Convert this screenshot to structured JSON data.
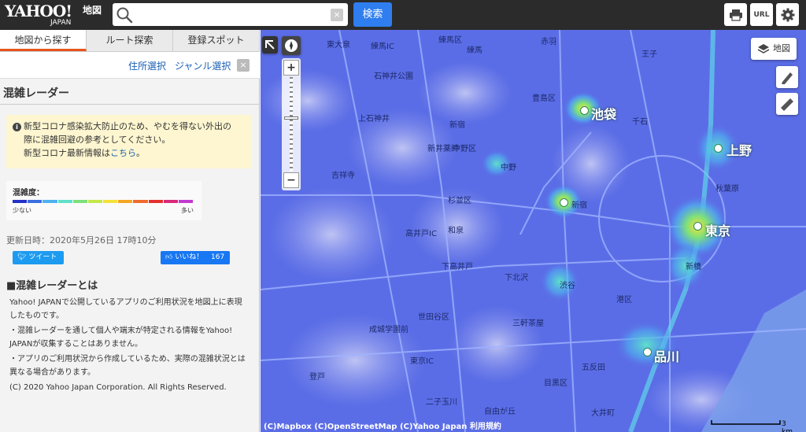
{
  "header": {
    "logo_main": "YAHOO!",
    "logo_sub": "JAPAN",
    "app_name": "地図",
    "search_placeholder": "",
    "search_button": "検索",
    "url_button": "URL",
    "icons": [
      "search-icon",
      "printer-icon",
      "gear-icon"
    ]
  },
  "panel": {
    "tabs": [
      "地図から探す",
      "ルート探索",
      "登録スポット"
    ],
    "subnav": {
      "address": "住所選択",
      "genre": "ジャンル選択",
      "close": "×"
    },
    "title": "混雑レーダー",
    "notice": {
      "line1": "新型コロナ感染拡大防止のため、やむを得ない外出の",
      "line2": "際に混雑回避の参考としてください。",
      "line3_prefix": "新型コロナ最新情報は",
      "line3_link": "こちら",
      "line3_suffix": "。"
    },
    "legend": {
      "title": "混雑度：",
      "low": "少ない",
      "high": "多い",
      "colors": [
        "#2431c9",
        "#3a6fe0",
        "#4fb1f0",
        "#5fe0c9",
        "#7ee07a",
        "#c4e84a",
        "#f5e13a",
        "#f5a623",
        "#ef6b2c",
        "#e5312e",
        "#d82a7a",
        "#c23ad1"
      ]
    },
    "updated": "更新日時：2020年5月26日 17時10分",
    "tweet": "ツイート",
    "like": "いいね！",
    "like_count": "167",
    "about_title": "■混雑レーダーとは",
    "about_p1": "Yahoo! JAPANで公開しているアプリのご利用状況を地図上に表現したものです。",
    "about_p2": "・混雑レーダーを通して個人や端末が特定される情報をYahoo! JAPANが収集することはありません。",
    "about_p3": "・アプリのご利用状況から作成しているため、実際の混雑状況とは異なる場合があります。",
    "about_p4": "(C) 2020 Yahoo Japan Corporation. All Rights Reserved."
  },
  "map": {
    "layer_button": "地図",
    "zoom_in": "+",
    "zoom_out": "−",
    "attribution": [
      "(C)Mapbox",
      "(C)OpenStreetMap",
      "(C)Yahoo Japan",
      "利用規約"
    ],
    "scale": "3 km",
    "labels": [
      {
        "t": "東大泉"
      },
      {
        "t": "練馬IC"
      },
      {
        "t": "練馬"
      },
      {
        "t": "練馬区"
      },
      {
        "t": "赤羽"
      },
      {
        "t": "王子"
      },
      {
        "t": "石神井公園"
      },
      {
        "t": "豊島区"
      },
      {
        "t": "上石神井"
      },
      {
        "t": "新宿"
      },
      {
        "t": "池袋"
      },
      {
        "t": "千石"
      },
      {
        "t": "新井薬師"
      },
      {
        "t": "中野区"
      },
      {
        "t": "上野"
      },
      {
        "t": "吉祥寺"
      },
      {
        "t": "中野"
      },
      {
        "t": "杉並区"
      },
      {
        "t": "秋葉原"
      },
      {
        "t": "新宿"
      },
      {
        "t": "東京"
      },
      {
        "t": "高井戸IC"
      },
      {
        "t": "和泉"
      },
      {
        "t": "新橋"
      },
      {
        "t": "下高井戸"
      },
      {
        "t": "下北沢"
      },
      {
        "t": "渋谷"
      },
      {
        "t": "港区"
      },
      {
        "t": "三軒茶屋"
      },
      {
        "t": "品川"
      },
      {
        "t": "成城学園前"
      },
      {
        "t": "世田谷区"
      },
      {
        "t": "目黒区"
      },
      {
        "t": "五反田"
      },
      {
        "t": "二子玉川"
      },
      {
        "t": "自由が丘"
      },
      {
        "t": "大井町"
      },
      {
        "t": "東京IC"
      },
      {
        "t": "登戸"
      }
    ]
  }
}
